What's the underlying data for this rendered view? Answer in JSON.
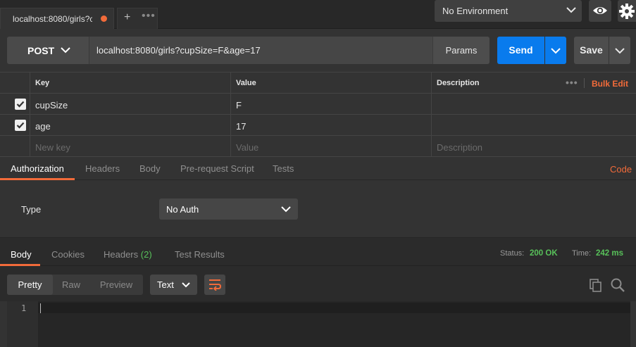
{
  "tabs": {
    "active_title": "localhost:8080/girls?cupSize=F&age=17",
    "add_label": "+",
    "more_label": "•••"
  },
  "environment": {
    "selected": "No Environment"
  },
  "request": {
    "method": "POST",
    "url": "localhost:8080/girls?cupSize=F&age=17",
    "params_label": "Params",
    "send_label": "Send",
    "save_label": "Save"
  },
  "params_table": {
    "headers": {
      "key": "Key",
      "value": "Value",
      "description": "Description"
    },
    "bulk_edit_label": "Bulk Edit",
    "rows": [
      {
        "checked": true,
        "key": "cupSize",
        "value": "F",
        "description": ""
      },
      {
        "checked": true,
        "key": "age",
        "value": "17",
        "description": ""
      }
    ],
    "placeholders": {
      "key": "New key",
      "value": "Value",
      "description": "Description"
    }
  },
  "request_tabs": {
    "items": [
      "Authorization",
      "Headers",
      "Body",
      "Pre-request Script",
      "Tests"
    ],
    "active": "Authorization",
    "code_label": "Code"
  },
  "auth": {
    "type_label": "Type",
    "selected": "No Auth"
  },
  "response_tabs": {
    "body": "Body",
    "cookies": "Cookies",
    "headers": "Headers",
    "headers_count": "(2)",
    "test_results": "Test Results",
    "active": "Body"
  },
  "response_meta": {
    "status_label": "Status:",
    "status_value": "200 OK",
    "time_label": "Time:",
    "time_value": "242 ms"
  },
  "response_toolbar": {
    "formats": [
      "Pretty",
      "Raw",
      "Preview"
    ],
    "active_format": "Pretty",
    "language": "Text"
  },
  "editor": {
    "line_number": "1"
  },
  "colors": {
    "accent": "#f26b3a",
    "send_blue": "#097bed",
    "success_green": "#58c15a"
  }
}
